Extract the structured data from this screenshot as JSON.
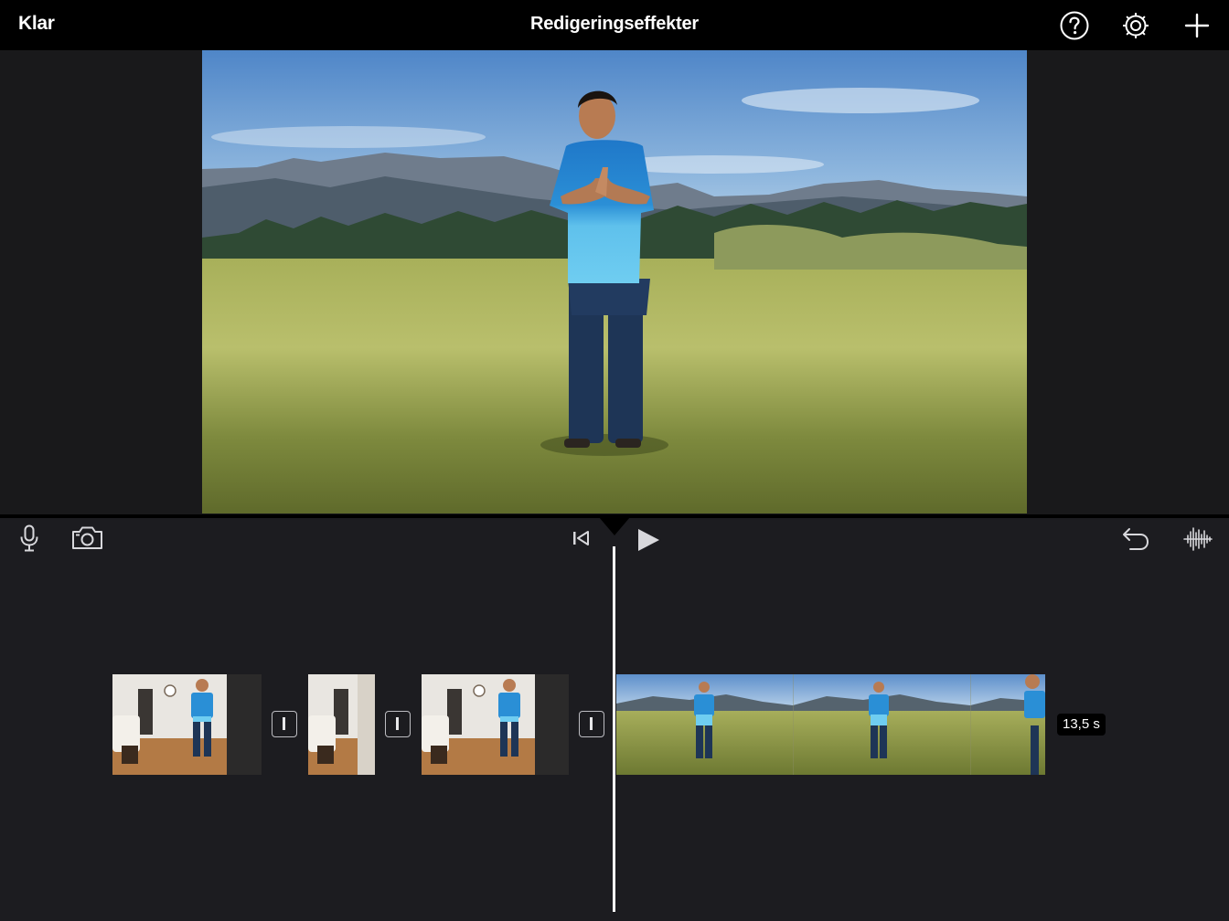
{
  "topbar": {
    "done_label": "Klar",
    "title": "Redigeringseffekter",
    "icons": [
      "help-icon",
      "settings-gear-icon",
      "add-plus-icon"
    ]
  },
  "viewer": {
    "content": "video-preview-frame"
  },
  "timeline_controls": {
    "left_icons": [
      "microphone-icon",
      "camera-icon"
    ],
    "center_icons": [
      "skip-to-start-icon",
      "play-icon"
    ],
    "right_icons": [
      "undo-icon",
      "audio-waveform-icon"
    ]
  },
  "timeline": {
    "clips": [
      {
        "name": "clip-indoor-1"
      },
      {
        "name": "clip-indoor-2"
      },
      {
        "name": "clip-indoor-3"
      },
      {
        "name": "clip-meadow"
      }
    ],
    "transitions": 3,
    "selected_clip_duration": "13,5 s"
  },
  "colors": {
    "topbar_bg": "#000000",
    "background": "#1c1c20",
    "playhead": "#ffffff",
    "accent_text": "#ffffff"
  }
}
